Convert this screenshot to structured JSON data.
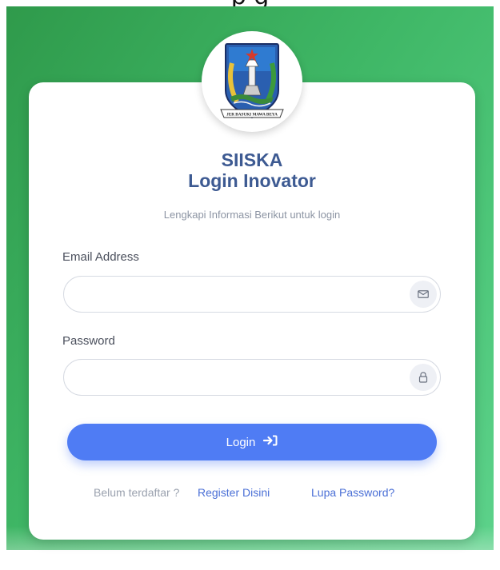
{
  "header": {
    "title": "SIISKA",
    "subtitle": "Login Inovator",
    "instruction": "Lengkapi Informasi Berikut untuk login"
  },
  "logo": {
    "name": "east-java-emblem",
    "banner_text": "JER BASUKI MAWA BEYA"
  },
  "form": {
    "email_label": "Email Address",
    "email_value": "",
    "email_placeholder": "",
    "password_label": "Password",
    "password_value": "",
    "password_placeholder": "",
    "login_label": "Login"
  },
  "footer": {
    "register_prompt": "Belum terdaftar ?",
    "register_link": "Register Disini",
    "forgot_link": "Lupa Password?"
  },
  "colors": {
    "background_gradient_start": "#2f9a4b",
    "background_gradient_end": "#5dd28b",
    "title": "#3d5a92",
    "primary_button": "#4f7cf4",
    "link": "#4a6fd6",
    "muted_text": "#9aa1ae"
  },
  "icons": {
    "email": "envelope-icon",
    "password": "lock-icon",
    "login": "sign-in-arrow-icon"
  }
}
